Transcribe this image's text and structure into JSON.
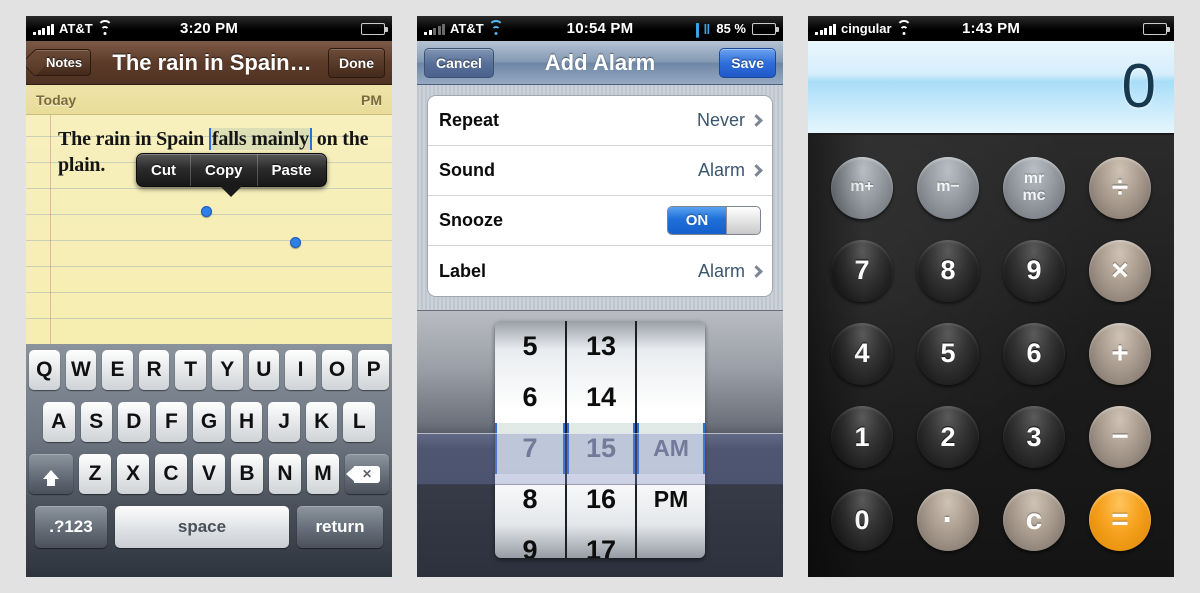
{
  "notes": {
    "status": {
      "carrier": "AT&T",
      "time": "3:20 PM",
      "signal_icon": "signal-bars-icon",
      "wifi_icon": "wifi-icon",
      "battery_icon": "battery-icon"
    },
    "nav": {
      "back_label": "Notes",
      "title": "The rain in Spain…",
      "done_label": "Done"
    },
    "paper": {
      "date": "Today",
      "time": "PM"
    },
    "text": {
      "before": "The rain in Spain ",
      "selected": "falls mainly",
      "after": " on the",
      "line2": "plain."
    },
    "edit_menu": {
      "cut": "Cut",
      "copy": "Copy",
      "paste": "Paste"
    },
    "keyboard": {
      "row1": [
        "Q",
        "W",
        "E",
        "R",
        "T",
        "Y",
        "U",
        "I",
        "O",
        "P"
      ],
      "row2": [
        "A",
        "S",
        "D",
        "F",
        "G",
        "H",
        "J",
        "K",
        "L"
      ],
      "row3": [
        "Z",
        "X",
        "C",
        "V",
        "B",
        "N",
        "M"
      ],
      "shift_icon": "shift-arrow-icon",
      "delete_icon": "backspace-icon",
      "numbers_label": ".?123",
      "space_label": "space",
      "return_label": "return"
    }
  },
  "alarm": {
    "status": {
      "carrier": "AT&T",
      "time": "10:54 PM",
      "bluetooth_icon": "bluetooth-icon",
      "battery_percent": "85 %",
      "battery_icon": "battery-icon"
    },
    "nav": {
      "cancel_label": "Cancel",
      "title": "Add Alarm",
      "save_label": "Save"
    },
    "rows": [
      {
        "label": "Repeat",
        "value": "Never",
        "type": "disclosure"
      },
      {
        "label": "Sound",
        "value": "Alarm",
        "type": "disclosure"
      },
      {
        "label": "Snooze",
        "value": "ON",
        "type": "toggle"
      },
      {
        "label": "Label",
        "value": "Alarm",
        "type": "disclosure"
      }
    ],
    "picker": {
      "hours": [
        "5",
        "6",
        "7",
        "8",
        "9"
      ],
      "minutes": [
        "13",
        "14",
        "15",
        "16",
        "17"
      ],
      "period": [
        "",
        "",
        "AM",
        "PM",
        ""
      ],
      "selected": {
        "hour": "7",
        "minute": "15",
        "period": "AM"
      }
    }
  },
  "calculator": {
    "status": {
      "carrier": "cingular",
      "time": "1:43 PM",
      "wifi_icon": "wifi-icon",
      "battery_icon": "battery-icon"
    },
    "display": "0",
    "keys": [
      {
        "label": "m+",
        "kind": "mem"
      },
      {
        "label": "m−",
        "kind": "mem"
      },
      {
        "label": "mr\nmc",
        "kind": "mem"
      },
      {
        "label": "÷",
        "kind": "op"
      },
      {
        "label": "7",
        "kind": "num"
      },
      {
        "label": "8",
        "kind": "num"
      },
      {
        "label": "9",
        "kind": "num"
      },
      {
        "label": "×",
        "kind": "op"
      },
      {
        "label": "4",
        "kind": "num"
      },
      {
        "label": "5",
        "kind": "num"
      },
      {
        "label": "6",
        "kind": "num"
      },
      {
        "label": "+",
        "kind": "op"
      },
      {
        "label": "1",
        "kind": "num"
      },
      {
        "label": "2",
        "kind": "num"
      },
      {
        "label": "3",
        "kind": "num"
      },
      {
        "label": "−",
        "kind": "op"
      },
      {
        "label": "0",
        "kind": "num"
      },
      {
        "label": "·",
        "kind": "op"
      },
      {
        "label": "c",
        "kind": "op"
      },
      {
        "label": "=",
        "kind": "eq"
      }
    ]
  },
  "colors": {
    "accent_blue": "#1e6fd9",
    "equals_orange": "#f6a21f",
    "notes_brown": "#5d3b29",
    "paper_yellow": "#f7f0bf",
    "display_blue": "#a8ddf8"
  }
}
